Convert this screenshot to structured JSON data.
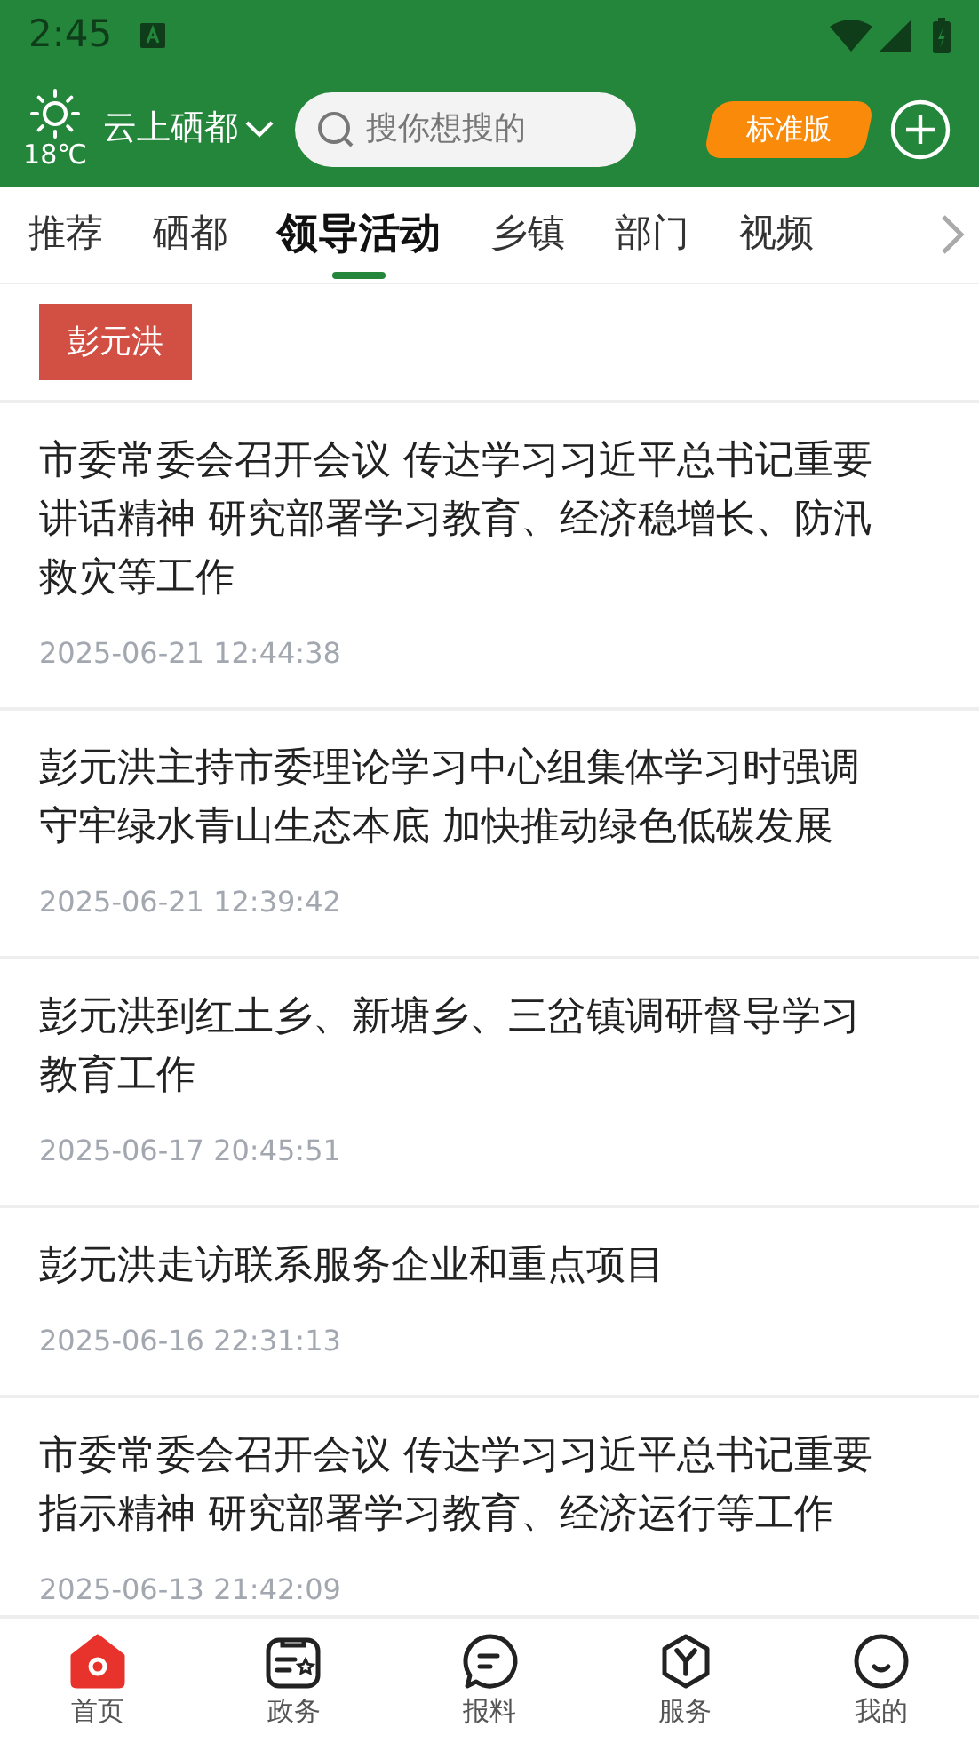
{
  "status_bar": {
    "time": "2:45"
  },
  "header": {
    "temperature": "18℃",
    "city": "云上硒都",
    "search": {
      "placeholder": "搜你想搜的"
    },
    "edition": "标准版"
  },
  "tabs": [
    {
      "label": "推荐",
      "selected": false
    },
    {
      "label": "硒都",
      "selected": false
    },
    {
      "label": "领导活动",
      "selected": true
    },
    {
      "label": "乡镇",
      "selected": false
    },
    {
      "label": "部门",
      "selected": false
    },
    {
      "label": "视频",
      "selected": false
    }
  ],
  "tag": "彭元洪",
  "articles": [
    {
      "title": "市委常委会召开会议 传达学习习近平总书记重要讲话精神 研究部署学习教育、经济稳增长、防汛救灾等工作",
      "time": "2025-06-21 12:44:38"
    },
    {
      "title": "彭元洪主持市委理论学习中心组集体学习时强调守牢绿水青山生态本底 加快推动绿色低碳发展",
      "time": "2025-06-21 12:39:42"
    },
    {
      "title": "彭元洪到红土乡、新塘乡、三岔镇调研督导学习教育工作",
      "time": "2025-06-17 20:45:51"
    },
    {
      "title": "彭元洪走访联系服务企业和重点项目",
      "time": "2025-06-16 22:31:13"
    },
    {
      "title": "市委常委会召开会议 传达学习习近平总书记重要指示精神 研究部署学习教育、经济运行等工作",
      "time": "2025-06-13 21:42:09"
    }
  ],
  "nav": [
    {
      "kind": "home",
      "label": "首页",
      "selected": true
    },
    {
      "kind": "affairs",
      "label": "政务",
      "selected": false
    },
    {
      "kind": "report",
      "label": "报料",
      "selected": false
    },
    {
      "kind": "service",
      "label": "服务",
      "selected": false
    },
    {
      "kind": "me",
      "label": "我的",
      "selected": false
    }
  ]
}
